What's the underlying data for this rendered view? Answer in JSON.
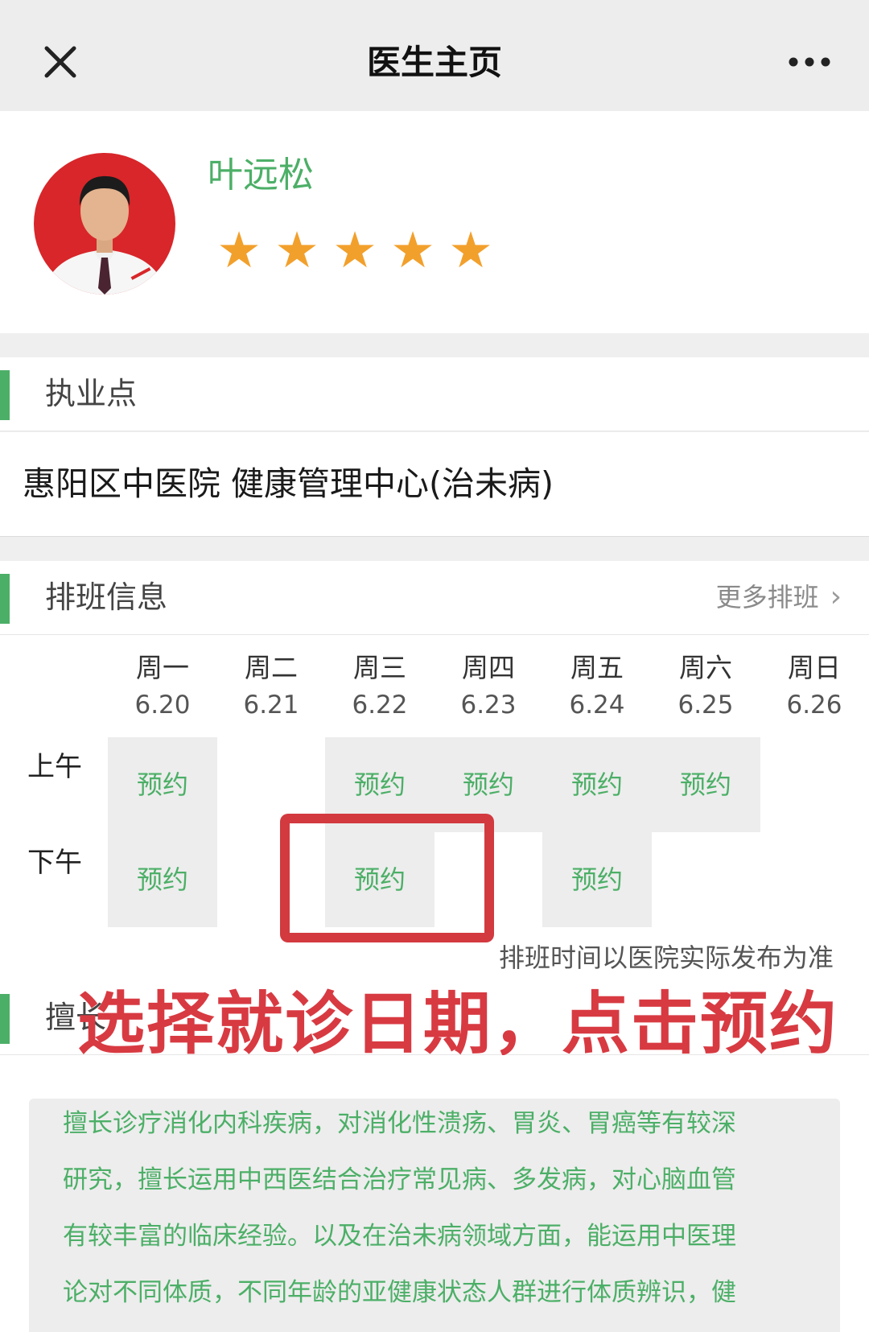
{
  "header": {
    "title": "医生主页",
    "close_icon": "close-icon",
    "more_icon": "more-dots-icon"
  },
  "doctor": {
    "name": "叶远松",
    "rating": 5,
    "rating_max": 5
  },
  "practice": {
    "section_title": "执业点",
    "location": "惠阳区中医院 健康管理中心(治未病)"
  },
  "schedule": {
    "section_title": "排班信息",
    "more_link": "更多排班",
    "days": [
      {
        "name": "周一",
        "date": "6.20"
      },
      {
        "name": "周二",
        "date": "6.21"
      },
      {
        "name": "周三",
        "date": "6.22"
      },
      {
        "name": "周四",
        "date": "6.23"
      },
      {
        "name": "周五",
        "date": "6.24"
      },
      {
        "name": "周六",
        "date": "6.25"
      },
      {
        "name": "周日",
        "date": "6.26"
      }
    ],
    "periods": [
      "上午",
      "下午"
    ],
    "slot_label": "预约",
    "morning_slots": [
      true,
      false,
      true,
      true,
      true,
      true,
      false
    ],
    "afternoon_slots": [
      true,
      false,
      true,
      false,
      true,
      false,
      false
    ],
    "note": "排班时间以医院实际发布为准"
  },
  "specialty": {
    "section_title": "擅长",
    "lines": [
      "擅长诊疗消化内科疾病，对消化性溃疡、胃炎、胃癌等有较深",
      "研究，擅长运用中西医结合治疗常见病、多发病，对心脑血管",
      "有较丰富的临床经验。以及在治未病领域方面，能运用中医理",
      "论对不同体质，不同年龄的亚健康状态人群进行体质辨识，健"
    ]
  },
  "annotation": {
    "text": "选择就诊日期，点击预约"
  },
  "colors": {
    "accent_green": "#4caf67",
    "star_orange": "#f2a02c",
    "highlight_red": "#d23a3f"
  }
}
